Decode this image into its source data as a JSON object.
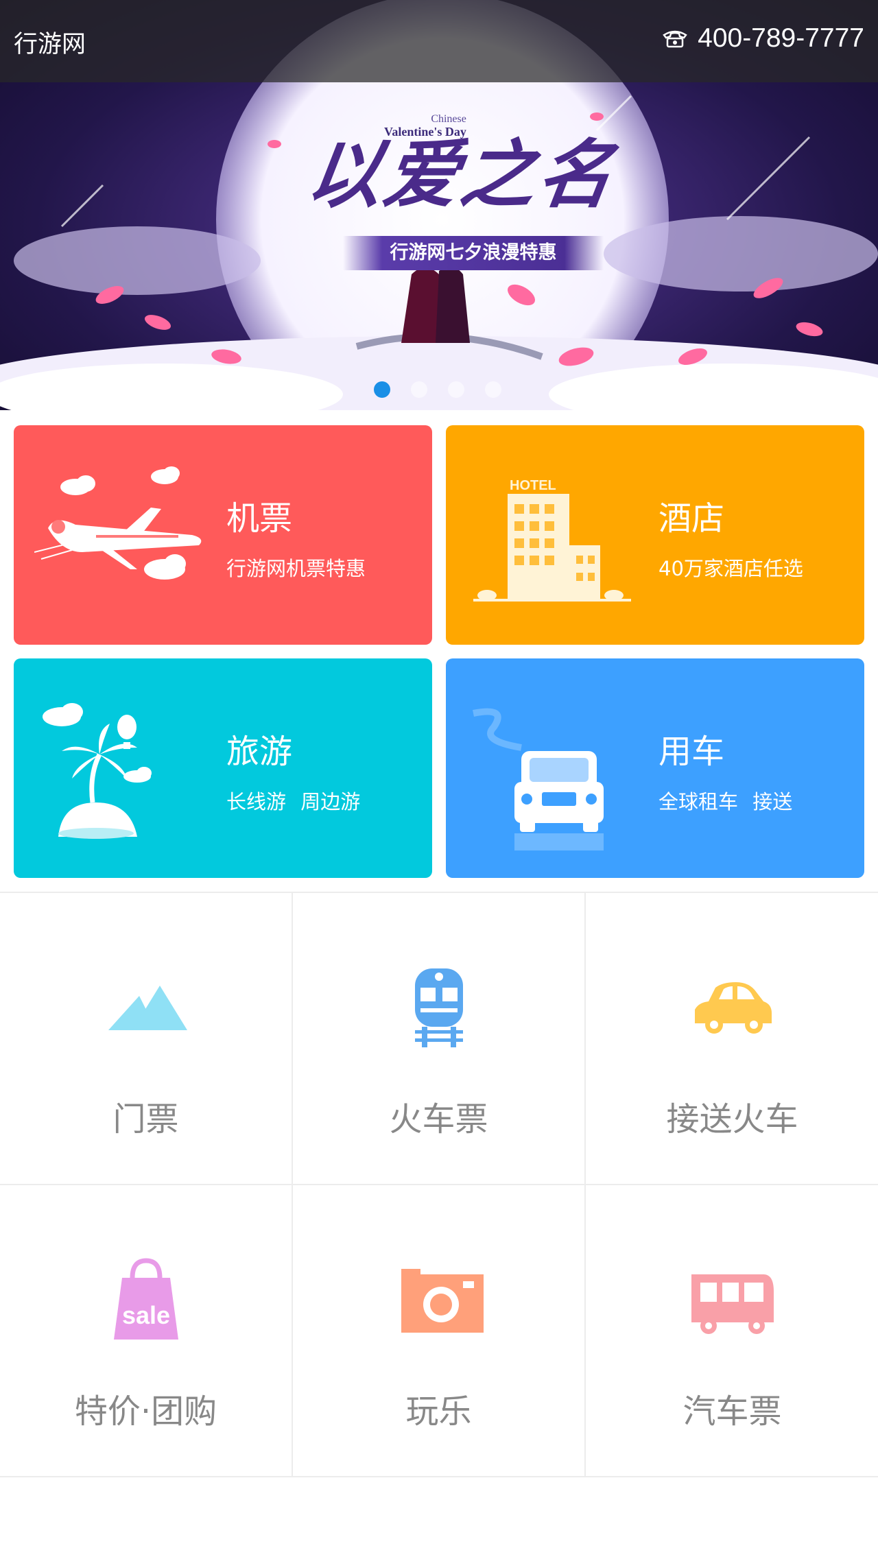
{
  "header": {
    "brand": "行游网",
    "phone": "400-789-7777"
  },
  "banner": {
    "calligraphy": "以爱之名",
    "event_en_small": "Chinese",
    "event_en": "Valentine's Day",
    "ribbon_text": "行游网七夕浪漫特惠",
    "slide_count": 4,
    "active_slide": 1
  },
  "cards": [
    {
      "title": "机票",
      "subtitle": "行游网机票特惠",
      "color": "#ff5a5a",
      "icon": "airplane-icon"
    },
    {
      "title": "酒店",
      "subtitle": "40万家酒店任选",
      "color": "#ffa700",
      "icon": "hotel-icon",
      "icon_text": "HOTEL"
    },
    {
      "title": "旅游",
      "subtitle": "长线游 周边游",
      "color": "#02c9dd",
      "icon": "island-icon"
    },
    {
      "title": "用车",
      "subtitle": "全球租车 接送",
      "color": "#3da0ff",
      "icon": "car-front-icon"
    }
  ],
  "grid": [
    {
      "label": "门票",
      "icon": "mountain-icon",
      "color": "#8fe0f5"
    },
    {
      "label": "火车票",
      "icon": "train-icon",
      "color": "#5aa8f0"
    },
    {
      "label": "接送火车",
      "icon": "car-icon",
      "color": "#ffc94f"
    },
    {
      "label": "特价·团购",
      "icon": "sale-bag-icon",
      "color": "#e89be8",
      "icon_text": "sale"
    },
    {
      "label": "玩乐",
      "icon": "camera-icon",
      "color": "#ffa07a"
    },
    {
      "label": "汽车票",
      "icon": "bus-icon",
      "color": "#f9a0a8"
    }
  ]
}
